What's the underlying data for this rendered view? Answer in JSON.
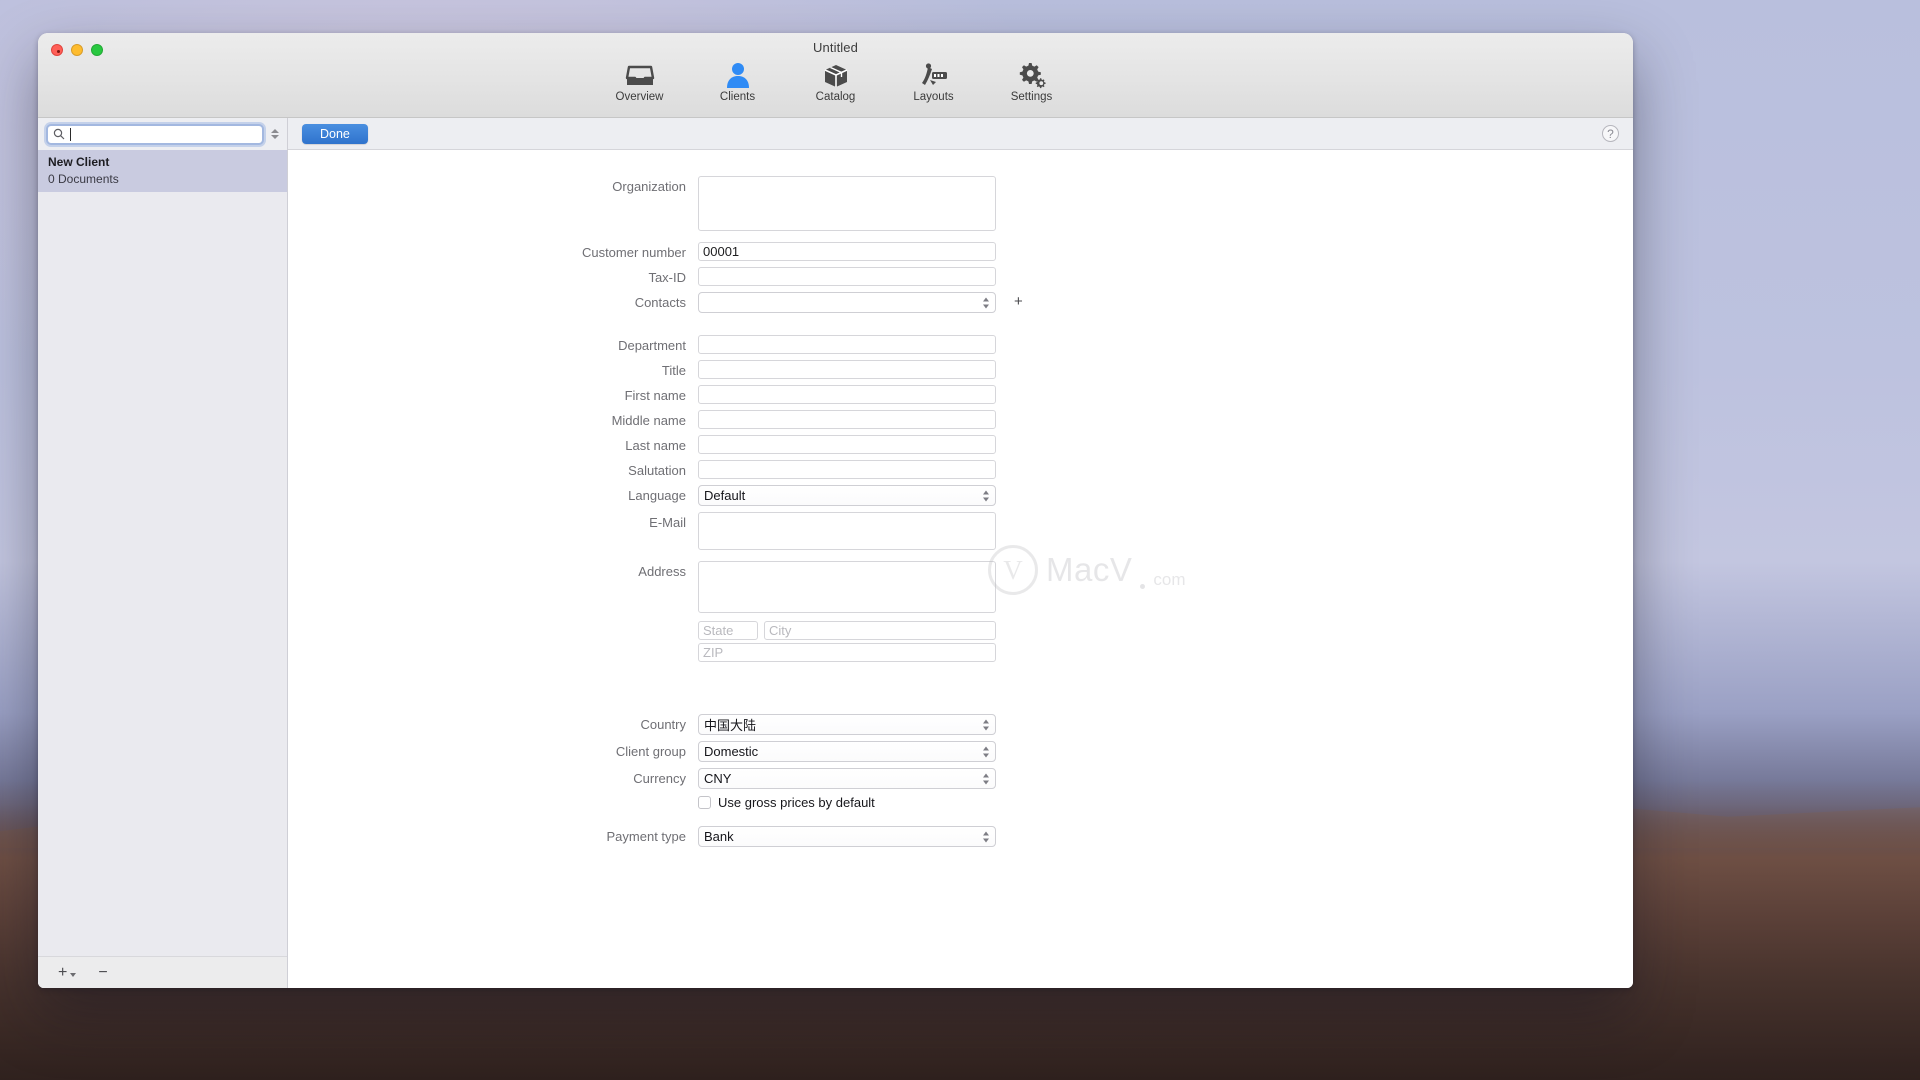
{
  "window": {
    "title": "Untitled",
    "controls": {
      "close": "close",
      "minimize": "minimize",
      "zoom": "zoom"
    }
  },
  "toolbar": {
    "items": [
      {
        "label": "Overview",
        "icon": "inbox-icon",
        "active": false
      },
      {
        "label": "Clients",
        "icon": "person-icon",
        "active": true
      },
      {
        "label": "Catalog",
        "icon": "box-icon",
        "active": false
      },
      {
        "label": "Layouts",
        "icon": "layouts-icon",
        "active": false
      },
      {
        "label": "Settings",
        "icon": "gears-icon",
        "active": false
      }
    ],
    "accent_color": "#2f7bd8"
  },
  "sidebar": {
    "search": {
      "value": "",
      "placeholder": ""
    },
    "items": [
      {
        "title": "New Client",
        "subtitle": "0 Documents",
        "selected": true
      }
    ],
    "footer": {
      "add_label": "+",
      "remove_label": "−"
    }
  },
  "detail": {
    "done_label": "Done",
    "help_label": "?",
    "fields": {
      "organization": {
        "label": "Organization",
        "value": ""
      },
      "customer_number": {
        "label": "Customer number",
        "value": "00001"
      },
      "tax_id": {
        "label": "Tax-ID",
        "value": ""
      },
      "contacts": {
        "label": "Contacts",
        "value": "",
        "add_label": "+"
      },
      "department": {
        "label": "Department",
        "value": ""
      },
      "title": {
        "label": "Title",
        "value": ""
      },
      "first_name": {
        "label": "First name",
        "value": ""
      },
      "middle_name": {
        "label": "Middle name",
        "value": ""
      },
      "last_name": {
        "label": "Last name",
        "value": ""
      },
      "salutation": {
        "label": "Salutation",
        "value": ""
      },
      "language": {
        "label": "Language",
        "value": "Default"
      },
      "email": {
        "label": "E-Mail",
        "value": ""
      },
      "address": {
        "label": "Address",
        "value": "",
        "state_placeholder": "State",
        "city_placeholder": "City",
        "zip_placeholder": "ZIP"
      },
      "country": {
        "label": "Country",
        "value": "中国大陆"
      },
      "client_group": {
        "label": "Client group",
        "value": "Domestic"
      },
      "currency": {
        "label": "Currency",
        "value": "CNY"
      },
      "gross_prices": {
        "label": "Use gross prices by default",
        "checked": false
      },
      "payment_type": {
        "label": "Payment type",
        "value": "Bank"
      }
    }
  },
  "watermark": {
    "mark": "V",
    "text": "MacV",
    "suffix": "com"
  }
}
